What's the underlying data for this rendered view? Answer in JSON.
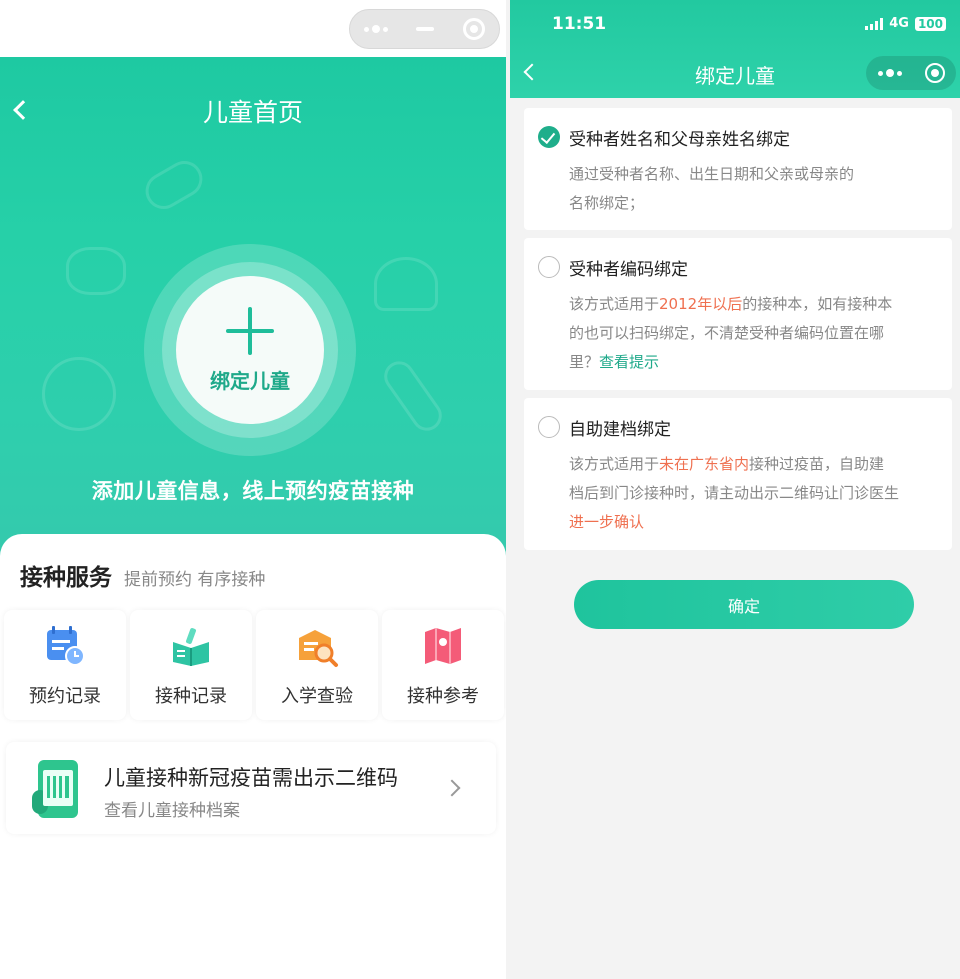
{
  "left_screen": {
    "nav_title": "儿童首页",
    "bind_label": "绑定儿童",
    "slogan": "添加儿童信息，线上预约疫苗接种",
    "service": {
      "title": "接种服务",
      "subtitle": "提前预约 有序接种",
      "items": [
        {
          "label": "预约记录",
          "icon": "calendar-clock-icon"
        },
        {
          "label": "接种记录",
          "icon": "vaccine-book-icon"
        },
        {
          "label": "入学查验",
          "icon": "school-search-icon"
        },
        {
          "label": "接种参考",
          "icon": "map-guide-icon"
        }
      ]
    },
    "qr_banner": {
      "title": "儿童接种新冠疫苗需出示二维码",
      "subtitle": "查看儿童接种档案",
      "icon": "phone-qr-icon"
    }
  },
  "right_screen": {
    "status": {
      "time": "11:51",
      "network": "4G",
      "battery": "100"
    },
    "nav_title": "绑定儿童",
    "options": [
      {
        "title": "受种者姓名和父母亲姓名绑定",
        "checked": true,
        "desc_lines": [
          "通过受种者名称、出生日期和父亲或母亲的",
          "名称绑定；"
        ]
      },
      {
        "title": "受种者编码绑定",
        "checked": false,
        "desc": {
          "pre": "该方式适用于",
          "highlight1": "2012年以后",
          "mid": "的接种本，如有接种本的也可以扫码绑定，不清楚受种者编码位置在哪里？",
          "link": "查看提示"
        }
      },
      {
        "title": "自助建档绑定",
        "checked": false,
        "desc": {
          "pre": "该方式适用于",
          "highlight1": "未在广东省内",
          "mid": "接种过疫苗，自助建档后到门诊接种时，请主动出示二维码让门诊医生",
          "highlight2": "进一步确认"
        }
      }
    ],
    "confirm_label": "确定"
  },
  "colors": {
    "primary": "#26d0a8",
    "accent_red": "#ef7050",
    "link_teal": "#1fa98a"
  }
}
